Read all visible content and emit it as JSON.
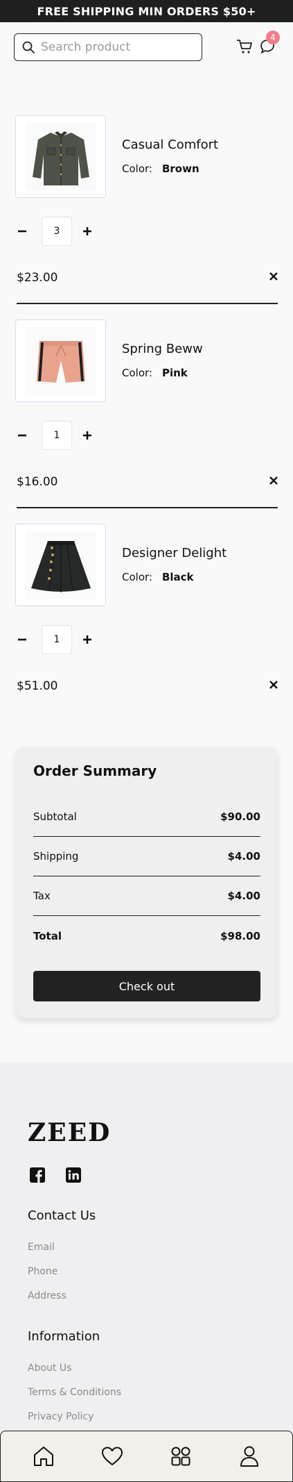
{
  "banner": {
    "text": "FREE SHIPPING MIN ORDERS $50+"
  },
  "header": {
    "search_placeholder": "Search product",
    "chat_badge": "4"
  },
  "cart": {
    "items": [
      {
        "name": "Casual Comfort",
        "color_label": "Color:",
        "color": "Brown",
        "quantity": "3",
        "price": "$23.00",
        "image": "shirt"
      },
      {
        "name": "Spring Beww",
        "color_label": "Color:",
        "color": "Pink",
        "quantity": "1",
        "price": "$16.00",
        "image": "shorts"
      },
      {
        "name": "Designer Delight",
        "color_label": "Color:",
        "color": "Black",
        "quantity": "1",
        "price": "$51.00",
        "image": "skirt"
      }
    ]
  },
  "summary": {
    "title": "Order Summary",
    "subtotal_label": "Subtotal",
    "subtotal": "$90.00",
    "shipping_label": "Shipping",
    "shipping": "$4.00",
    "tax_label": "Tax",
    "tax": "$4.00",
    "total_label": "Total",
    "total": "$98.00",
    "checkout_label": "Check out"
  },
  "footer": {
    "logo": "ZEED",
    "contact_heading": "Contact Us",
    "contact_links": [
      "Email",
      "Phone",
      "Address"
    ],
    "info_heading": "Information",
    "info_links": [
      "About Us",
      "Terms & Conditions",
      "Privacy Policy"
    ]
  },
  "icons": {
    "search": "search-icon",
    "cart": "cart-icon",
    "chat": "chat-icon",
    "minus": "minus-icon",
    "plus": "plus-icon",
    "remove": "close-icon",
    "facebook": "facebook-icon",
    "linkedin": "linkedin-icon",
    "home": "home-icon",
    "wishlist": "heart-icon",
    "categories": "grid-icon",
    "profile": "user-icon"
  },
  "colors": {
    "banner_bg": "#1f1f1f",
    "badge": "#f07d8a",
    "checkout_bg": "#222222",
    "nav_bg": "#f3efe9"
  }
}
